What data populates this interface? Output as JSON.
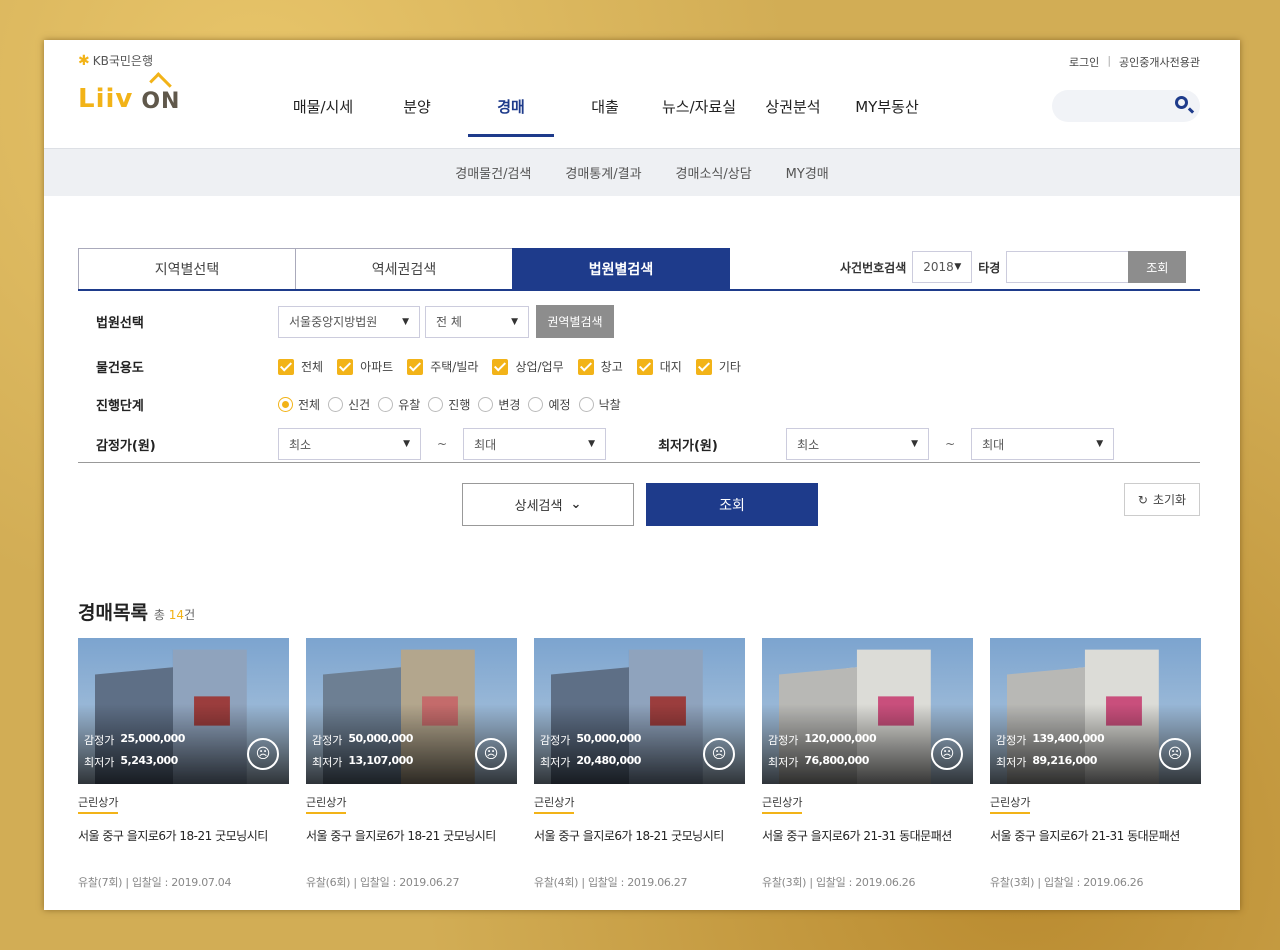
{
  "header": {
    "bank_name": "KB국민은행",
    "logo_text_1": "Liiv",
    "logo_text_2": "ON",
    "login": "로그인",
    "agent_link": "공인중개사전용관",
    "nav": [
      "매물/시세",
      "분양",
      "경매",
      "대출",
      "뉴스/자료실",
      "상권분석",
      "MY부동산"
    ],
    "active_nav": "경매"
  },
  "subnav": [
    "경매물건/검색",
    "경매통계/결과",
    "경매소식/상담",
    "MY경매"
  ],
  "search_tabs": [
    "지역별선택",
    "역세권검색",
    "법원별검색"
  ],
  "active_tab": "법원별검색",
  "case_search": {
    "label": "사건번호검색",
    "year": "2018",
    "suffix": "타경",
    "button": "조회"
  },
  "filters": {
    "court": {
      "label": "법원선택",
      "court_value": "서울중앙지방법원",
      "branch_value": "전 체",
      "region_button": "권역별검색"
    },
    "usage": {
      "label": "물건용도",
      "options": [
        "전체",
        "아파트",
        "주택/빌라",
        "상업/업무",
        "창고",
        "대지",
        "기타"
      ]
    },
    "stage": {
      "label": "진행단계",
      "options": [
        "전체",
        "신건",
        "유찰",
        "진행",
        "변경",
        "예정",
        "낙찰"
      ],
      "selected": "전체"
    },
    "appraisal": {
      "label": "감정가(원)",
      "min": "최소",
      "max": "최대"
    },
    "minimum": {
      "label": "최저가(원)",
      "min": "최소",
      "max": "최대"
    },
    "tilde": "~"
  },
  "actions": {
    "detail": "상세검색",
    "query": "조회",
    "reset": "초기화"
  },
  "list": {
    "title": "경매목록",
    "total_prefix": "총",
    "total": "14",
    "total_suffix": "건",
    "appraisal_label": "감정가",
    "min_label": "최저가",
    "items": [
      {
        "appraisal": "25,000,000",
        "minimum": "5,243,000",
        "category": "근린상가",
        "address": "서울 중구 을지로6가 18-21 굿모닝시티",
        "status": "유찰(7회) | 입찰일 : 2019.07.04"
      },
      {
        "appraisal": "50,000,000",
        "minimum": "13,107,000",
        "category": "근린상가",
        "address": "서울 중구 을지로6가 18-21 굿모닝시티",
        "status": "유찰(6회) | 입찰일 : 2019.06.27"
      },
      {
        "appraisal": "50,000,000",
        "minimum": "20,480,000",
        "category": "근린상가",
        "address": "서울 중구 을지로6가 18-21 굿모닝시티",
        "status": "유찰(4회) | 입찰일 : 2019.06.27"
      },
      {
        "appraisal": "120,000,000",
        "minimum": "76,800,000",
        "category": "근린상가",
        "address": "서울 중구 을지로6가 21-31 동대문패션",
        "status": "유찰(3회) | 입찰일 : 2019.06.26"
      },
      {
        "appraisal": "139,400,000",
        "minimum": "89,216,000",
        "category": "근린상가",
        "address": "서울 중구 을지로6가 21-31 동대문패션",
        "status": "유찰(3회) | 입찰일 : 2019.06.26"
      }
    ]
  },
  "colors": {
    "primary": "#1e3b8b",
    "accent": "#f2b318",
    "frame": "#d2ad55"
  }
}
